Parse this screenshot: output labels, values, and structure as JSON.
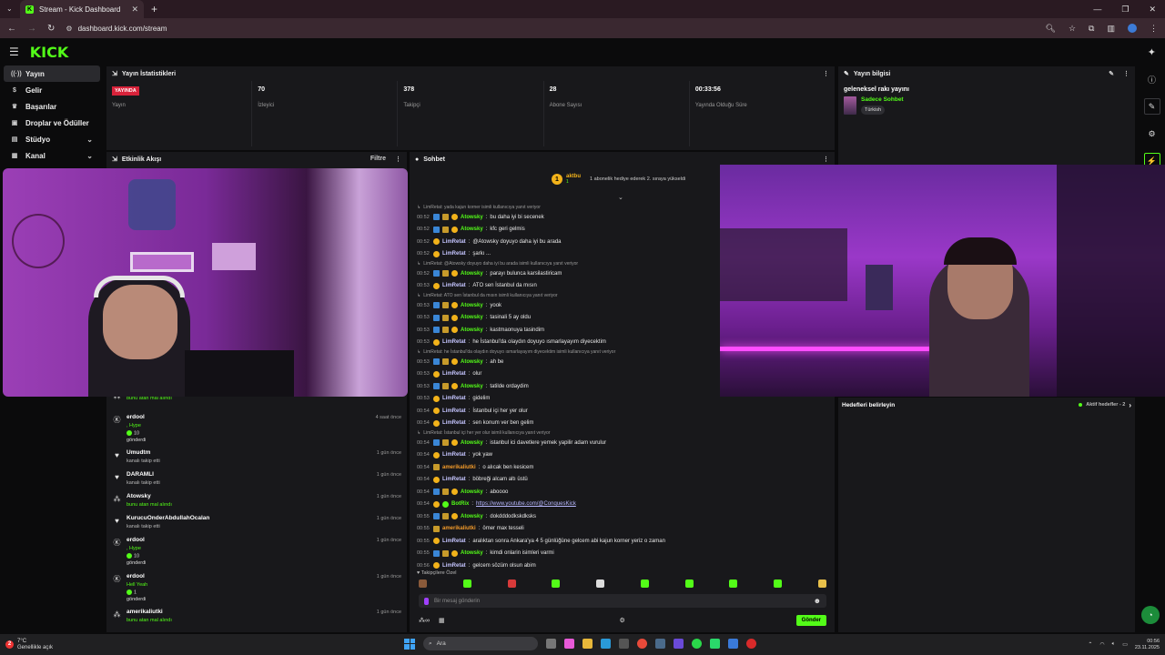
{
  "browser": {
    "tab_title": "Stream - Kick Dashboard",
    "url": "dashboard.kick.com/stream",
    "new_tab": "+",
    "tab_close": "✕"
  },
  "kick": {
    "logo": "KICK"
  },
  "sidebar": {
    "items": [
      {
        "label": "Yayın",
        "icon": "broadcast-icon",
        "active": true
      },
      {
        "label": "Gelir",
        "icon": "dollar-icon"
      },
      {
        "label": "Başarılar",
        "icon": "trophy-icon"
      },
      {
        "label": "Droplar ve Ödüller",
        "icon": "gift-icon"
      },
      {
        "label": "Stüdyo",
        "icon": "studio-icon",
        "chevron": true
      },
      {
        "label": "Kanal",
        "icon": "channel-icon",
        "chevron": true
      }
    ]
  },
  "stats": {
    "title": "Yayın İstatistikleri",
    "live_badge": "YAYINDA",
    "items": [
      {
        "value": "",
        "label": "Yayın"
      },
      {
        "value": "70",
        "label": "İzleyici"
      },
      {
        "value": "378",
        "label": "Takipçi"
      },
      {
        "value": "28",
        "label": "Abone Sayısı"
      },
      {
        "value": "00:33:56",
        "label": "Yayında Olduğu Süre"
      }
    ]
  },
  "info": {
    "title": "Yayın bilgisi",
    "stream_title": "geleneksel rakı yayını",
    "category": "Sadece Sohbet",
    "language": "Türkish"
  },
  "goals": {
    "title": "Hedefleri belirleyin",
    "active_label": "Aktif hedefler - 2"
  },
  "activity": {
    "title": "Etkinlik Akışı",
    "filter": "Filtre",
    "items": [
      {
        "name": "",
        "desc": "bunu atan mal alındı",
        "time": "",
        "icon": "drop-icon",
        "green": true
      },
      {
        "name": "erdool",
        "desc": "gönderdi",
        "time": "4 saat önce",
        "icon": "kick-icon",
        "hype": ", Hype",
        "count": "10"
      },
      {
        "name": "Umudtm",
        "desc": "kanalı takip etti",
        "time": "1 gün önce",
        "icon": "heart-icon"
      },
      {
        "name": "DARAMLI",
        "desc": "kanalı takip etti",
        "time": "1 gün önce",
        "icon": "heart-icon"
      },
      {
        "name": "Atowsky",
        "desc": "bunu atan mal alındı",
        "time": "1 gün önce",
        "icon": "drop-icon",
        "green": true
      },
      {
        "name": "KurucuOnderAbdullahOcalan",
        "desc": "kanalı takip etti",
        "time": "1 gün önce",
        "icon": "heart-icon"
      },
      {
        "name": "erdool",
        "desc": "gönderdi",
        "time": "1 gün önce",
        "icon": "kick-icon",
        "hype": ", Hype",
        "count": "10"
      },
      {
        "name": "erdool",
        "desc": "gönderdi",
        "time": "1 gün önce",
        "icon": "kick-icon",
        "hype": "Hell Yeah",
        "count": "1"
      },
      {
        "name": "amerikaliutki",
        "desc": "bunu atan mal alındı",
        "time": "1 gün önce",
        "icon": "drop-icon",
        "green": true
      }
    ]
  },
  "chat": {
    "title": "Sohbet",
    "pinned_user": "aktbu",
    "pinned_sub": "1",
    "pinned_text": "1 abonelik hediye ederek 2. sıraya yükseldi",
    "lines": [
      {
        "type": "reply",
        "text": "LimRetat: yada kajun korner isimli kullanıcıya yanıt veriyor"
      },
      {
        "t": "00:52",
        "user": "Atowsky",
        "cls": "c-ato",
        "badges": [
          "blue",
          "gold",
          "sub"
        ],
        "msg": "bu daha iyi bi secenek"
      },
      {
        "t": "00:52",
        "user": "Atowsky",
        "cls": "c-ato",
        "badges": [
          "blue",
          "gold",
          "sub"
        ],
        "msg": "kfc geri gelmis"
      },
      {
        "t": "00:52",
        "user": "LimRetat",
        "cls": "c-lim",
        "badges": [
          "sub"
        ],
        "msg": "@Atowsky doyuyo daha iyi bu arada"
      },
      {
        "t": "00:52",
        "user": "LimRetat",
        "cls": "c-lim",
        "badges": [
          "sub"
        ],
        "msg": "şarkı ..."
      },
      {
        "type": "reply",
        "text": "LimRetat: @Atowsky doyuyo daha iyi bu arada isimli kullanıcıya yanıt veriyor"
      },
      {
        "t": "00:52",
        "user": "Atowsky",
        "cls": "c-ato",
        "badges": [
          "blue",
          "gold",
          "sub"
        ],
        "msg": "parayı bulunca karsilastiricam"
      },
      {
        "t": "00:53",
        "user": "LimRetat",
        "cls": "c-lim",
        "badges": [
          "sub"
        ],
        "msg": "ATO sen İstanbul da mısın"
      },
      {
        "type": "reply",
        "text": "LimRetat: ATO sen İstanbul da mısın isimli kullanıcıya yanıt veriyor"
      },
      {
        "t": "00:53",
        "user": "Atowsky",
        "cls": "c-ato",
        "badges": [
          "blue",
          "gold",
          "sub"
        ],
        "msg": "yook"
      },
      {
        "t": "00:53",
        "user": "Atowsky",
        "cls": "c-ato",
        "badges": [
          "blue",
          "gold",
          "sub"
        ],
        "msg": "tasinali 5 ay oldu"
      },
      {
        "t": "00:53",
        "user": "Atowsky",
        "cls": "c-ato",
        "badges": [
          "blue",
          "gold",
          "sub"
        ],
        "msg": "kastmaonuya tasindim"
      },
      {
        "t": "00:53",
        "user": "LimRetat",
        "cls": "c-lim",
        "badges": [
          "sub"
        ],
        "msg": "he İstanbul'da olaydın doyuyo ısmarlayayım diyecektim"
      },
      {
        "type": "reply",
        "text": "LimRetat: he İstanbul'da olaydın doyuyo ısmarlayayım diyecektim isimli kullanıcıya yanıt veriyor"
      },
      {
        "t": "00:53",
        "user": "Atowsky",
        "cls": "c-ato",
        "badges": [
          "blue",
          "gold",
          "sub"
        ],
        "msg": "ah be"
      },
      {
        "t": "00:53",
        "user": "LimRetat",
        "cls": "c-lim",
        "badges": [
          "sub"
        ],
        "msg": "olur"
      },
      {
        "t": "00:53",
        "user": "Atowsky",
        "cls": "c-ato",
        "badges": [
          "blue",
          "gold",
          "sub"
        ],
        "msg": "tatilde ordaydim"
      },
      {
        "t": "00:53",
        "user": "LimRetat",
        "cls": "c-lim",
        "badges": [
          "sub"
        ],
        "msg": "gidelim"
      },
      {
        "t": "00:54",
        "user": "LimRetat",
        "cls": "c-lim",
        "badges": [
          "sub"
        ],
        "msg": "İstanbul içi her yer olur"
      },
      {
        "t": "00:54",
        "user": "LimRetat",
        "cls": "c-lim",
        "badges": [
          "sub"
        ],
        "msg": "sen konum ver ben gelim"
      },
      {
        "type": "reply",
        "text": "LimRetat: İstanbul içi her yer olur isimli kullanıcıya yanıt veriyor"
      },
      {
        "t": "00:54",
        "user": "Atowsky",
        "cls": "c-ato",
        "badges": [
          "blue",
          "gold",
          "sub"
        ],
        "msg": "istanbul ici davetlere yemek yapilir adam vurulur"
      },
      {
        "t": "00:54",
        "user": "LimRetat",
        "cls": "c-lim",
        "badges": [
          "sub"
        ],
        "msg": "yok yaw"
      },
      {
        "t": "00:54",
        "user": "amerikaliutki",
        "cls": "c-ame",
        "badges": [
          "gold"
        ],
        "msg": "o alıcak ben kesicem"
      },
      {
        "t": "00:54",
        "user": "LimRetat",
        "cls": "c-lim",
        "badges": [
          "sub"
        ],
        "msg": "böbreği alcam altı üstü"
      },
      {
        "t": "00:54",
        "user": "Atowsky",
        "cls": "c-ato",
        "badges": [
          "blue",
          "gold",
          "sub"
        ],
        "msg": "aboooo"
      },
      {
        "t": "00:54",
        "user": "BotRix",
        "cls": "c-bot",
        "badges": [
          "sub",
          "grn"
        ],
        "msg": "https://www.youtube.com/@ConquesKick",
        "link": true
      },
      {
        "t": "00:55",
        "user": "Atowsky",
        "cls": "c-ato",
        "badges": [
          "blue",
          "gold",
          "sub"
        ],
        "msg": "dokdddodkskdksks"
      },
      {
        "t": "00:55",
        "user": "amerikaliutki",
        "cls": "c-ame",
        "badges": [
          "gold"
        ],
        "msg": "ömer max tesseli"
      },
      {
        "t": "00:55",
        "user": "LimRetat",
        "cls": "c-lim",
        "badges": [
          "sub"
        ],
        "msg": "aralıktan sonra Ankara'ya 4 5 günlüğüne gelcem abi kajun korner yeriz o zaman"
      },
      {
        "t": "00:55",
        "user": "Atowsky",
        "cls": "c-ato",
        "badges": [
          "blue",
          "gold",
          "sub"
        ],
        "msg": "kimdi onlarin isimleri varmi"
      },
      {
        "t": "00:56",
        "user": "LimRetat",
        "cls": "c-lim",
        "badges": [
          "sub"
        ],
        "msg": "gelcem sözüm olsun abim"
      }
    ],
    "followers_only": "Takipçilere Özel",
    "input_placeholder": "Bir mesaj gönderin",
    "send_label": "Gönder"
  },
  "taskbar": {
    "temp": "7°C",
    "weather_text": "Genellikle açık",
    "badge": "2",
    "search": "Ara",
    "time": "00:56",
    "date": "23.11.2025"
  },
  "colors": {
    "accent": "#53fc18",
    "live": "#d8223a",
    "panel": "#18181b",
    "bg": "#0b0b0c"
  }
}
